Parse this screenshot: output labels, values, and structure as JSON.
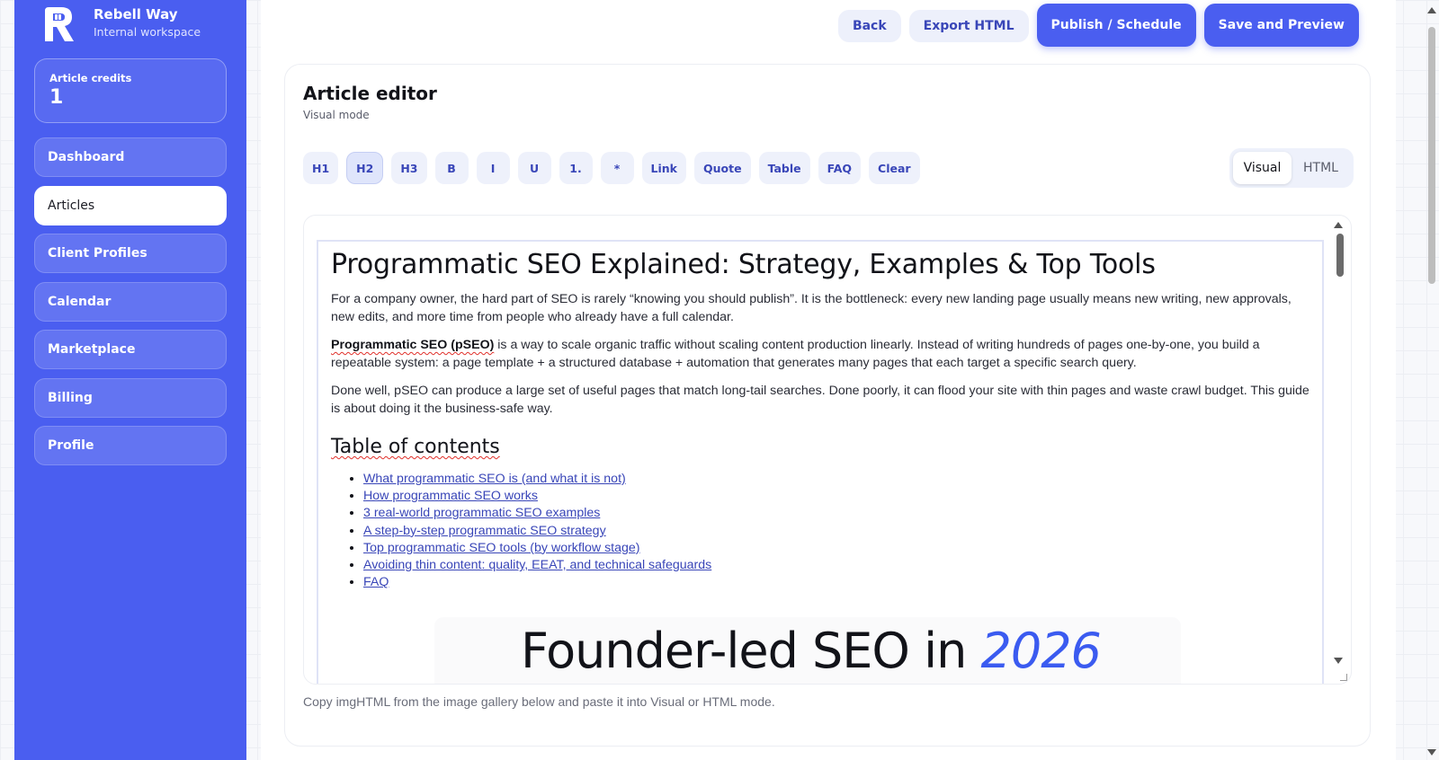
{
  "brand": {
    "name": "Rebell Way",
    "subtitle": "Internal workspace",
    "logo_icon": "r-fist-logo-icon"
  },
  "credits": {
    "label": "Article credits",
    "value": "1"
  },
  "nav": [
    {
      "label": "Dashboard",
      "active": false
    },
    {
      "label": "Articles",
      "active": true
    },
    {
      "label": "Client Profiles",
      "active": false
    },
    {
      "label": "Calendar",
      "active": false
    },
    {
      "label": "Marketplace",
      "active": false
    },
    {
      "label": "Billing",
      "active": false
    },
    {
      "label": "Profile",
      "active": false
    }
  ],
  "topbar": {
    "back": "Back",
    "export": "Export HTML",
    "publish": "Publish / Schedule",
    "save": "Save and Preview"
  },
  "editor": {
    "title": "Article editor",
    "mode_label": "Visual mode",
    "tools": [
      "H1",
      "H2",
      "H3",
      "B",
      "I",
      "U",
      "1.",
      "*",
      "Link",
      "Quote",
      "Table",
      "FAQ",
      "Clear"
    ],
    "active_tool": "H2",
    "modes": [
      "Visual",
      "HTML"
    ],
    "active_mode": "Visual",
    "hint": "Copy imgHTML from the image gallery below and paste it into Visual or HTML mode."
  },
  "article": {
    "title": "Programmatic SEO Explained: Strategy, Examples & Top Tools",
    "p1": "For a company owner, the hard part of SEO is rarely “knowing you should publish”. It is the bottleneck: every new landing page usually means new writing, new approvals, new edits, and more time from people who already have a full calendar.",
    "p2_bold": "Programmatic SEO (pSEO)",
    "p2_rest": " is a way to scale organic traffic without scaling content production linearly. Instead of writing hundreds of pages one-by-one, you build a repeatable system: a page template + a structured database + automation that generates many pages that each target a specific search query.",
    "p3": "Done well, pSEO can produce a large set of useful pages that match long-tail searches. Done poorly, it can flood your site with thin pages and waste crawl budget. This guide is about doing it the business-safe way.",
    "toc_heading": "Table of contents",
    "toc": [
      "What programmatic SEO is (and what it is not)",
      "How programmatic SEO works",
      "3 real-world programmatic SEO examples",
      "A step-by-step programmatic SEO strategy",
      "Top programmatic SEO tools (by workflow stage)",
      "Avoiding thin content: quality, EEAT, and technical safeguards",
      "FAQ"
    ],
    "hero_text": "Founder-led SEO in ",
    "hero_year": "2026"
  },
  "colors": {
    "accent": "#4a5ef0",
    "link": "#3946b8",
    "spellcheck": "#e0302a"
  }
}
